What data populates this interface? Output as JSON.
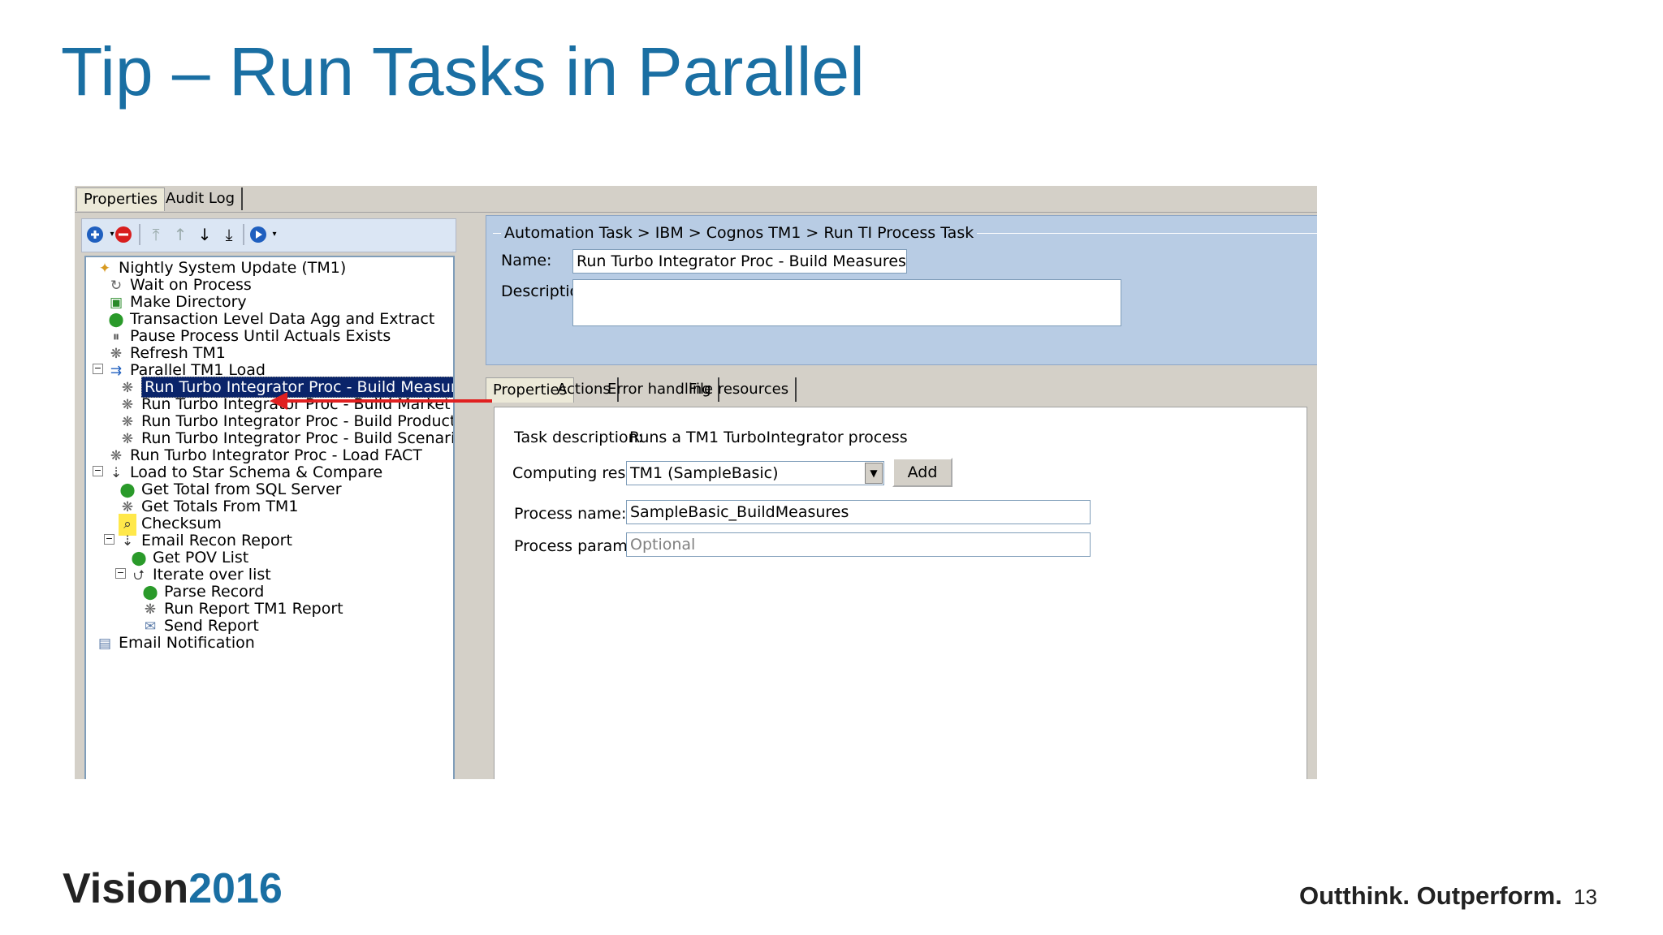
{
  "slide": {
    "title": "Tip – Run Tasks in Parallel",
    "logo_word": "Vision",
    "logo_year": "2016",
    "tagline": "Outthink. Outperform.",
    "page_number": "13"
  },
  "top_tabs": [
    "Properties",
    "Audit Log"
  ],
  "toolbar_icons": [
    "add-icon",
    "remove-icon",
    "move-top-icon",
    "move-up-icon",
    "move-down-icon",
    "move-bottom-icon",
    "run-icon"
  ],
  "tree": {
    "items": [
      {
        "label": "Nightly System Update (TM1)",
        "icon": "nightly-system-icon"
      },
      {
        "label": "Wait on Process",
        "icon": "wait-icon"
      },
      {
        "label": "Make Directory",
        "icon": "folder-icon"
      },
      {
        "label": "Transaction Level Data Agg and Extract",
        "icon": "pin-icon"
      },
      {
        "label": "Pause Process Until Actuals Exists",
        "icon": "pause-icon"
      },
      {
        "label": "Refresh TM1",
        "icon": "tm1-process-icon"
      },
      {
        "label": "Parallel TM1 Load",
        "icon": "parallel-icon"
      },
      {
        "label": "Run Turbo Integrator Proc - Build Measures",
        "icon": "tm1-process-icon"
      },
      {
        "label": "Run Turbo Integrator Proc - Build Market",
        "icon": "tm1-process-icon"
      },
      {
        "label": "Run Turbo Integrator Proc - Build Product",
        "icon": "tm1-process-icon"
      },
      {
        "label": "Run Turbo Integrator Proc - Build Scenario",
        "icon": "tm1-process-icon"
      },
      {
        "label": "Run Turbo Integrator Proc - Load FACT",
        "icon": "tm1-process-icon"
      },
      {
        "label": "Load to Star Schema & Compare",
        "icon": "sequence-icon"
      },
      {
        "label": "Get Total from SQL Server",
        "icon": "pin-icon"
      },
      {
        "label": "Get Totals From TM1",
        "icon": "tm1-process-icon"
      },
      {
        "label": "Checksum",
        "icon": "checksum-icon"
      },
      {
        "label": "Email Recon Report",
        "icon": "sequence-icon"
      },
      {
        "label": "Get POV List",
        "icon": "pin-icon"
      },
      {
        "label": "Iterate over list",
        "icon": "loop-icon"
      },
      {
        "label": "Parse Record",
        "icon": "pin-icon"
      },
      {
        "label": "Run Report TM1 Report",
        "icon": "tm1-process-icon"
      },
      {
        "label": "Send Report",
        "icon": "envelope-icon"
      },
      {
        "label": "Email Notification",
        "icon": "email-notification-icon"
      }
    ]
  },
  "header": {
    "breadcrumb": "Automation Task > IBM > Cognos TM1 > Run TI Process Task",
    "name_label": "Name:",
    "name_value": "Run Turbo Integrator Proc - Build Measures",
    "description_label": "Description:",
    "description_value": ""
  },
  "inner_tabs": [
    "Properties",
    "Actions",
    "Error handling",
    "File resources"
  ],
  "properties": {
    "task_description_label": "Task description:",
    "task_description_value": "Runs a TM1 TurboIntegrator process",
    "computing_resource_label": "Computing resource:",
    "computing_resource_value": "TM1 (SampleBasic)",
    "add_button": "Add",
    "process_name_label": "Process name:",
    "process_name_value": "SampleBasic_BuildMeasures",
    "process_parameters_label": "Process parameters:",
    "process_parameters_placeholder": "Optional"
  },
  "colors": {
    "title_blue": "#1a6fa3",
    "selection": "#0a246a",
    "header_panel": "#b8cce4",
    "arrow": "#e02020"
  }
}
